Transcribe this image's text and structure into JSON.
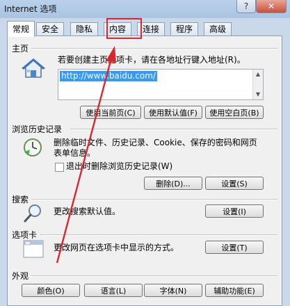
{
  "window": {
    "title": "Internet 选项",
    "help_label": "?",
    "close_label": "✕"
  },
  "tabs": [
    {
      "label": "常规",
      "active": true
    },
    {
      "label": "安全"
    },
    {
      "label": "隐私"
    },
    {
      "label": "内容"
    },
    {
      "label": "连接"
    },
    {
      "label": "程序"
    },
    {
      "label": "高级"
    }
  ],
  "home": {
    "title": "主页",
    "description": "若要创建主页选项卡，请在各地址行键入地址(R)。",
    "url": "http://www.baidu.com/",
    "buttons": {
      "current": "使用当前页(C)",
      "default": "使用默认值(F)",
      "blank": "使用空白页(B)"
    },
    "icon": "house-icon"
  },
  "history": {
    "title": "浏览历史记录",
    "description_line1": "删除临时文件、历史记录、Cookie、保存的密码和网页",
    "description_line2": "表单信息。",
    "checkbox_label": "退出时删除浏览历史记录(W)",
    "delete_button": "删除(D)...",
    "settings_button": "设置(S)",
    "icon": "history-clock-icon"
  },
  "search": {
    "title": "搜索",
    "description": "更改搜索默认值。",
    "settings_button": "设置(I)",
    "icon": "magnifier-icon"
  },
  "tabs_section": {
    "title": "选项卡",
    "description": "更改网页在选项卡中显示的方式。",
    "settings_button": "设置(T)",
    "icon": "tabs-window-icon"
  },
  "appearance": {
    "title": "外观",
    "buttons": {
      "colors": "颜色(O)",
      "languages": "语言(L)",
      "fonts": "字体(N)",
      "accessibility": "辅助功能(E)"
    }
  },
  "annotation": {
    "highlight_color": "#e0242b"
  }
}
